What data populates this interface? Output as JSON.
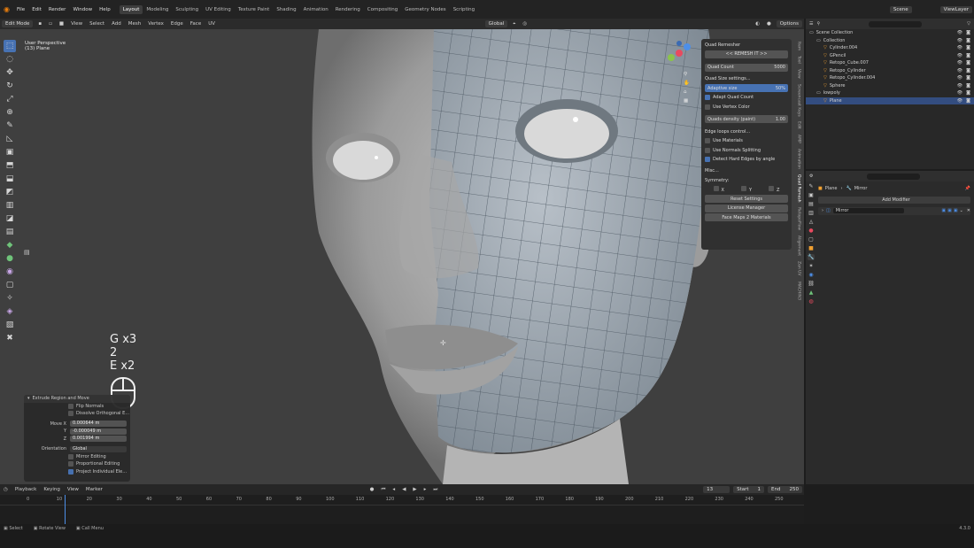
{
  "menus": [
    "File",
    "Edit",
    "Render",
    "Window",
    "Help"
  ],
  "workspaces": [
    "Layout",
    "Modeling",
    "Sculpting",
    "UV Editing",
    "Texture Paint",
    "Shading",
    "Animation",
    "Rendering",
    "Compositing",
    "Geometry Nodes",
    "Scripting"
  ],
  "scene_label": "Scene",
  "viewlayer_label": "ViewLayer",
  "header": {
    "mode": "Edit Mode",
    "items": [
      "View",
      "Select",
      "Add",
      "Mesh",
      "Vertex",
      "Edge",
      "Face",
      "UV"
    ],
    "orientation": "Global",
    "options": "Options"
  },
  "viewport_overlay": {
    "perspective": "User Perspective",
    "object": "(13) Plane"
  },
  "key_overlay": [
    "G x3",
    "2",
    "E x2"
  ],
  "operator_panel": {
    "title": "Extrude Region and Move",
    "flip_normals": "Flip Normals",
    "dissolve": "Dissolve Orthogonal E...",
    "move_x_label": "Move X",
    "move_x": "0.000644 m",
    "y_label": "Y",
    "y_value": "-0.000049 m",
    "z_label": "Z",
    "z_value": "0.001994 m",
    "orientation_label": "Orientation",
    "orientation_value": "Global",
    "mirror_editing": "Mirror Editing",
    "proportional": "Proportional Editing",
    "project": "Project Individual Ele..."
  },
  "quad_remesher": {
    "title": "Quad Remesher",
    "remesh_button": "<< REMESH IT >>",
    "quad_count_label": "Quad Count",
    "quad_count": "5000",
    "quad_size_settings": "Quad Size settings...",
    "adaptive_size_label": "Adaptive size",
    "adaptive_size": "50%",
    "adapt_quad_count": "Adapt Quad Count",
    "use_vertex_color": "Use Vertex Color",
    "quads_density_label": "Quads density (paint)",
    "quads_density": "1.00",
    "edge_loops": "Edge loops control...",
    "use_materials": "Use Materials",
    "use_normals": "Use Normals Splitting",
    "detect_hard": "Detect Hard Edges by angle",
    "misc": "Misc...",
    "symmetry": "Symmetry:",
    "sym_x": "X",
    "sym_y": "Y",
    "sym_z": "Z",
    "reset": "Reset Settings",
    "license": "License Manager",
    "face_maps": "Face Maps 2 Materials"
  },
  "vertical_tabs": [
    "Item",
    "Tool",
    "View",
    "Screencast Keys",
    "Edit",
    "AMP",
    "Animation",
    "Quad Remesh",
    "RetopoFlow",
    "Alignment",
    "Zen UV",
    "MACHIN3"
  ],
  "outliner": {
    "search_placeholder": "",
    "rows": [
      {
        "label": "Scene Collection",
        "indent": 0,
        "sel": false
      },
      {
        "label": "Collection",
        "indent": 1,
        "sel": false
      },
      {
        "label": "Cylinder.004",
        "indent": 2,
        "sel": false
      },
      {
        "label": "GPencil",
        "indent": 2,
        "sel": false
      },
      {
        "label": "Retopo_Cube.007",
        "indent": 2,
        "sel": false
      },
      {
        "label": "Retopo_Cylinder",
        "indent": 2,
        "sel": false
      },
      {
        "label": "Retopo_Cylinder.004",
        "indent": 2,
        "sel": false
      },
      {
        "label": "Sphere",
        "indent": 2,
        "sel": false
      },
      {
        "label": "lowpoly",
        "indent": 1,
        "sel": false
      },
      {
        "label": "Plane",
        "indent": 2,
        "sel": true
      }
    ]
  },
  "properties": {
    "object": "Plane",
    "modifier_target": "Mirror",
    "add_modifier": "Add Modifier",
    "modifier_name": "Mirror"
  },
  "timeline": {
    "playback": "Playback",
    "keying": "Keying",
    "view": "View",
    "marker": "Marker",
    "current_frame": "13",
    "start_label": "Start",
    "start": "1",
    "end_label": "End",
    "end": "250",
    "ticks": [
      "0",
      "10",
      "20",
      "30",
      "40",
      "50",
      "60",
      "70",
      "80",
      "90",
      "100",
      "110",
      "120",
      "130",
      "140",
      "150",
      "160",
      "170",
      "180",
      "190",
      "200",
      "210",
      "220",
      "230",
      "240",
      "250"
    ]
  },
  "statusbar": {
    "select": "Select",
    "rotate": "Rotate View",
    "call_menu": "Call Menu",
    "version": "4.3.0"
  }
}
